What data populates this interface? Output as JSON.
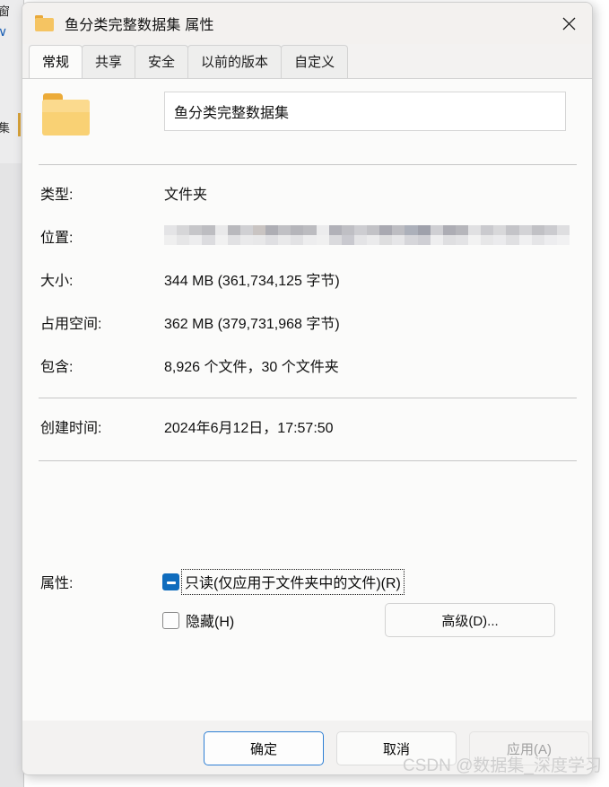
{
  "background_window": {
    "fragment_top": "窗",
    "fragment_mid": "∨",
    "fragment_low": "集"
  },
  "titlebar": {
    "icon": "folder-icon",
    "title": "鱼分类完整数据集 属性",
    "close_label": "×"
  },
  "tabs": [
    {
      "label": "常规",
      "active": true
    },
    {
      "label": "共享",
      "active": false
    },
    {
      "label": "安全",
      "active": false
    },
    {
      "label": "以前的版本",
      "active": false
    },
    {
      "label": "自定义",
      "active": false
    }
  ],
  "general": {
    "folder_name": "鱼分类完整数据集",
    "rows": [
      {
        "label": "类型:",
        "value": "文件夹"
      },
      {
        "label": "位置:",
        "value": "",
        "redacted": true
      },
      {
        "label": "大小:",
        "value": "344 MB (361,734,125 字节)"
      },
      {
        "label": "占用空间:",
        "value": "362 MB (379,731,968 字节)"
      },
      {
        "label": "包含:",
        "value": "8,926 个文件，30 个文件夹"
      },
      {
        "label": "创建时间:",
        "value": "2024年6月12日，17:57:50"
      }
    ],
    "attributes_label": "属性:",
    "readonly_label": "只读(仅应用于文件夹中的文件)(R)",
    "readonly_state": "indeterminate",
    "hidden_label": "隐藏(H)",
    "hidden_state": "unchecked",
    "advanced_label": "高级(D)..."
  },
  "footer": {
    "ok_label": "确定",
    "cancel_label": "取消",
    "apply_label": "应用(A)",
    "apply_disabled": true
  },
  "watermark": "CSDN @数据集_深度学习",
  "colors": {
    "accent": "#0f6cbd",
    "default_button_border": "#2e7fd4",
    "dialog_bg": "#f3f2f1",
    "page_bg": "#fbfbfa",
    "folder_yellow": "#f9d174"
  }
}
